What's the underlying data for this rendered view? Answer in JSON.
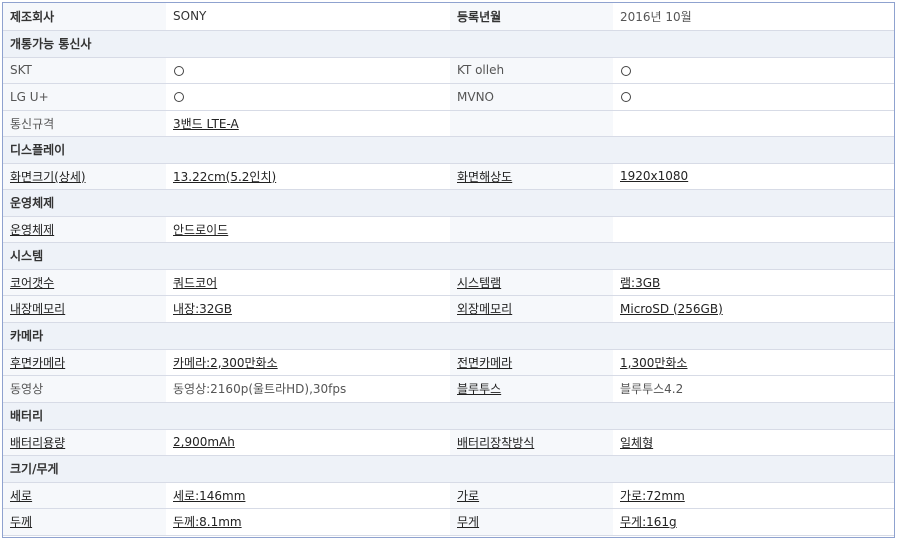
{
  "rows": [
    {
      "type": "pair",
      "l1": "제조회사",
      "v1": "SONY",
      "l2": "등록년월",
      "v2": "2016년 10월"
    },
    {
      "type": "section",
      "title": "개통가능 통신사"
    },
    {
      "type": "carrier",
      "l1": "SKT",
      "v1": "○",
      "l2": "KT olleh",
      "v2": "○"
    },
    {
      "type": "carrier",
      "l1": "LG U+",
      "v1": "○",
      "l2": "MVNO",
      "v2": "○"
    },
    {
      "type": "pair",
      "l1": "통신규격",
      "v1": "3밴드 LTE-A",
      "l2": "",
      "v2": ""
    },
    {
      "type": "section",
      "title": "디스플레이"
    },
    {
      "type": "pair",
      "l1": "화면크기(상세)",
      "v1": "13.22cm(5.2인치)",
      "l2": "화면해상도",
      "v2": "1920x1080"
    },
    {
      "type": "section",
      "title": "운영체제"
    },
    {
      "type": "pair",
      "l1": "운영체제",
      "v1": "안드로이드",
      "l2": "",
      "v2": ""
    },
    {
      "type": "section",
      "title": "시스템"
    },
    {
      "type": "pair",
      "l1": "코어갯수",
      "v1": "쿼드코어",
      "l2": "시스템램",
      "v2": "램:3GB"
    },
    {
      "type": "pair",
      "l1": "내장메모리",
      "v1": "내장:32GB",
      "l2": "외장메모리",
      "v2": "MicroSD (256GB)"
    },
    {
      "type": "section",
      "title": "카메라"
    },
    {
      "type": "pair",
      "l1": "후면카메라",
      "v1": "카메라:2,300만화소",
      "l2": "전면카메라",
      "v2": "1,300만화소"
    },
    {
      "type": "pair",
      "l1": "동영상",
      "v1": "동영상:2160p(울트라HD),30fps",
      "l2": "블루투스",
      "v2": "블루투스4.2"
    },
    {
      "type": "section",
      "title": "배터리"
    },
    {
      "type": "pair",
      "l1": "배터리용량",
      "v1": "2,900mAh",
      "l2": "배터리장착방식",
      "v2": "일체형"
    },
    {
      "type": "section",
      "title": "크기/무게"
    },
    {
      "type": "pair",
      "l1": "세로",
      "v1": "세로:146mm",
      "l2": "가로",
      "v2": "가로:72mm"
    },
    {
      "type": "pair",
      "l1": "두께",
      "v1": "두께:8.1mm",
      "l2": "무게",
      "v2": "무게:161g"
    }
  ]
}
